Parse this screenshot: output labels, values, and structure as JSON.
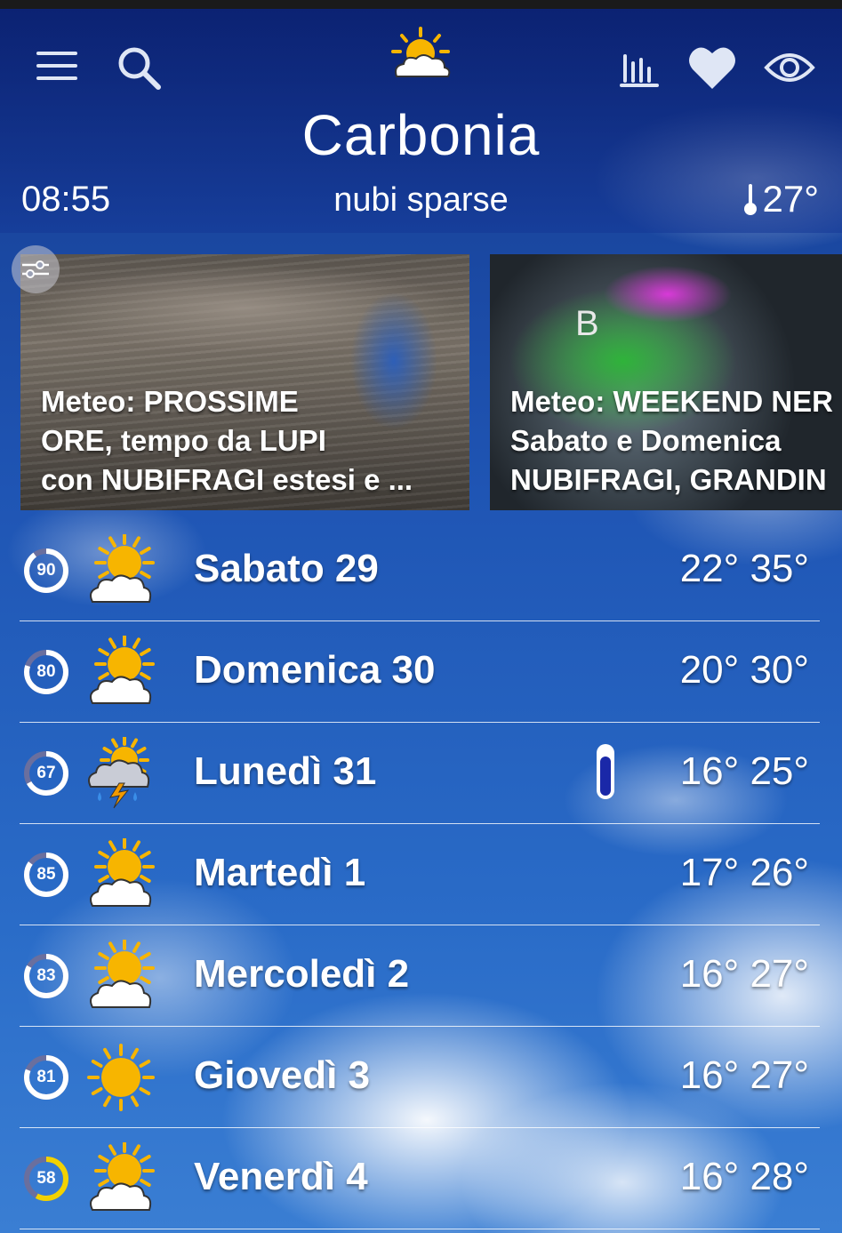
{
  "header": {
    "city": "Carbonia",
    "time": "08:55",
    "condition": "nubi sparse",
    "temperature": "27°",
    "icons": [
      "menu-icon",
      "search-icon",
      "partly-sunny-icon",
      "chart-icon",
      "heart-icon",
      "eye-icon"
    ]
  },
  "news": [
    {
      "title": "Meteo: PROSSIME\nORE, tempo da LUPI\ncon NUBIFRAGI estesi e ..."
    },
    {
      "title": "Meteo: WEEKEND NER\nSabato e Domenica\nNUBIFRAGI, GRANDIN"
    }
  ],
  "map_label": "B",
  "forecast": [
    {
      "score": "90",
      "score_value": 90,
      "ring_color": "#ffffff",
      "icon": "sun-cloud-icon",
      "day": "Sabato 29",
      "temps": "22° 35°"
    },
    {
      "score": "80",
      "score_value": 80,
      "ring_color": "#ffffff",
      "icon": "sun-cloud-icon",
      "day": "Domenica 30",
      "temps": "20° 30°"
    },
    {
      "score": "67",
      "score_value": 67,
      "ring_color": "#ffffff",
      "icon": "thunderstorm-icon",
      "day": "Lunedì 31",
      "temps": "16° 25°",
      "thermo": true
    },
    {
      "score": "85",
      "score_value": 85,
      "ring_color": "#ffffff",
      "icon": "sun-cloud-icon",
      "day": "Martedì 1",
      "temps": "17° 26°"
    },
    {
      "score": "83",
      "score_value": 83,
      "ring_color": "#ffffff",
      "icon": "sun-cloud-icon",
      "day": "Mercoledì 2",
      "temps": "16° 27°"
    },
    {
      "score": "81",
      "score_value": 81,
      "ring_color": "#ffffff",
      "icon": "sun-icon",
      "day": "Giovedì 3",
      "temps": "16° 27°"
    },
    {
      "score": "58",
      "score_value": 58,
      "ring_color": "#f2d200",
      "icon": "sun-cloud-icon",
      "day": "Venerdì 4",
      "temps": "16° 28°"
    }
  ],
  "colors": {
    "accent_sun": "#f7b500",
    "ring_track": "#6a6f9e",
    "thermo_fill": "#1a28a8"
  }
}
